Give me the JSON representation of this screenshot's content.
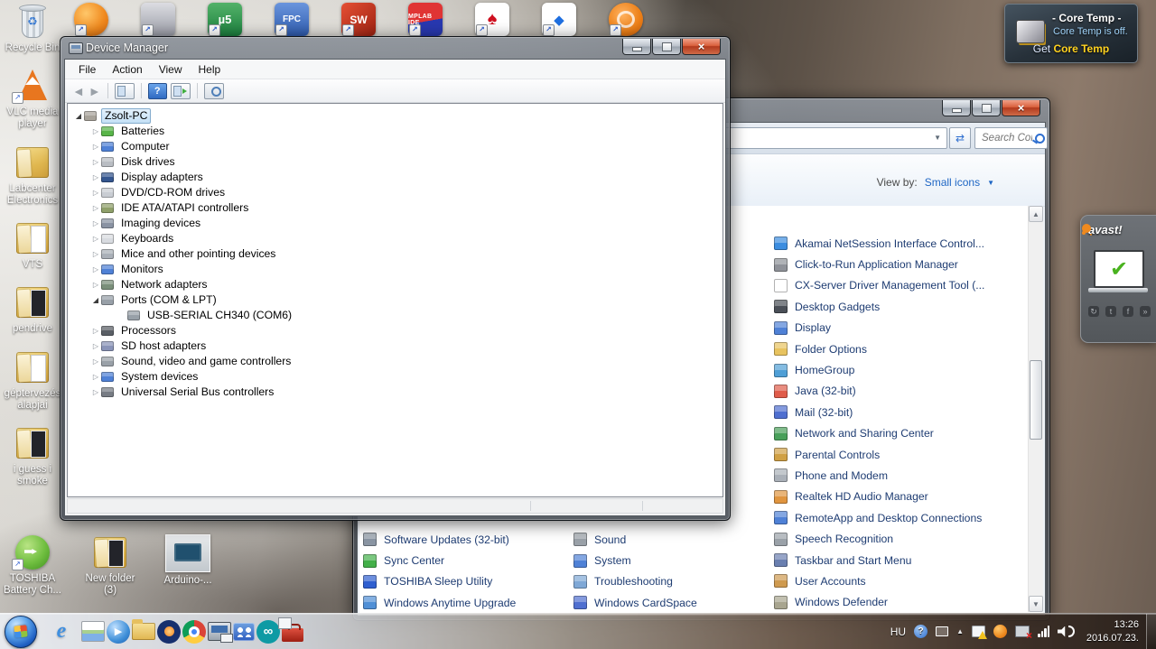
{
  "ui": {
    "shortcut_arrow": "↗",
    "close": "×",
    "back": "◄",
    "forward": "►",
    "help": "?",
    "refresh": "⇄",
    "dropdown": "▼",
    "scroll_up": "▲",
    "scroll_down": "▼",
    "tray_hidden": "▲",
    "check": "✔",
    "recycle": "♻",
    "play": "▶",
    "infinity": "∞",
    "social": [
      "↻",
      "t",
      "f",
      "»"
    ]
  },
  "shortcut_row": [
    {
      "name": "avast-shortcut-icon",
      "glyph": "",
      "cls": "sc-avast",
      "shortcut": true
    },
    {
      "name": "media-suite-shortcut-icon",
      "glyph": "",
      "cls": "sc-gray",
      "shortcut": true
    },
    {
      "name": "keil-uvision5-shortcut-icon",
      "glyph": "µ5",
      "cls": "sc-keil",
      "shortcut": true
    },
    {
      "name": "fpc-shortcut-icon",
      "glyph": "FPC",
      "cls": "sc-fpc",
      "shortcut": true
    },
    {
      "name": "solidworks-shortcut-icon",
      "glyph": "SW",
      "cls": "sc-sw",
      "shortcut": true
    },
    {
      "name": "mplab-ide-shortcut-icon",
      "glyph": "MPLAB IDE",
      "cls": "sc-mplab",
      "shortcut": true
    },
    {
      "name": "pokerstars-shortcut-icon",
      "glyph": "♠",
      "cls": "sc-ps",
      "shortcut": true
    },
    {
      "name": "dropbox-shortcut-icon",
      "glyph": "◆",
      "cls": "sc-dropbox",
      "shortcut": true
    },
    {
      "name": "orange-wheel-shortcut-icon",
      "glyph": "",
      "cls": "sc-orange",
      "shortcut": true
    }
  ],
  "desktop_icons": [
    {
      "name": "desktop-icon-recycle-bin",
      "label": "Recycle Bin",
      "cls": "ic-bin",
      "glyph": "♻"
    },
    {
      "name": "desktop-icon-vlc",
      "label": "VLC media player",
      "cls": "ic-vlc",
      "shortcut": true
    },
    {
      "name": "desktop-icon-labcenter",
      "label": "Labcenter Electronics",
      "cls": "ic-folder"
    },
    {
      "name": "desktop-icon-vts",
      "label": "VTS",
      "cls": "ic-folder-doc"
    },
    {
      "name": "desktop-icon-pendrive",
      "label": "pendrive",
      "cls": "ic-folder-photo"
    },
    {
      "name": "desktop-icon-geptervezes",
      "label": "géptervezés alapjai",
      "cls": "ic-folder-doc"
    },
    {
      "name": "desktop-icon-i-guess-i-smoke",
      "label": "i guess i smoke",
      "cls": "ic-folder-photo"
    }
  ],
  "desktop_icons_bottom": [
    {
      "name": "desktop-icon-toshiba-battery",
      "label": "TOSHIBA Battery Ch...",
      "cls": "ic-toshiba",
      "shortcut": true
    },
    {
      "name": "desktop-icon-new-folder-3",
      "label": "New folder (3)",
      "cls": "ic-folder-photo"
    },
    {
      "name": "desktop-icon-arduino-photo",
      "label": "Arduino-...",
      "cls": "ic-arduino"
    }
  ],
  "device_manager": {
    "title": "Device Manager",
    "menu": [
      {
        "name": "menu-file",
        "label": "File"
      },
      {
        "name": "menu-action",
        "label": "Action"
      },
      {
        "name": "menu-view",
        "label": "View"
      },
      {
        "name": "menu-help",
        "label": "Help"
      }
    ],
    "tree": [
      {
        "name": "tree-item-zsolt-pc",
        "label": "Zsolt-PC",
        "twisty": "◢",
        "ic": "#a8a39a",
        "cls": "lvl0 sel open"
      },
      {
        "name": "tree-item-batteries",
        "label": "Batteries",
        "twisty": "▷",
        "ic": "#58b549",
        "cls": "lvl1"
      },
      {
        "name": "tree-item-computer",
        "label": "Computer",
        "twisty": "▷",
        "ic": "#4f81d6",
        "cls": "lvl1"
      },
      {
        "name": "tree-item-disk-drives",
        "label": "Disk drives",
        "twisty": "▷",
        "ic": "#b9bdc3",
        "cls": "lvl1"
      },
      {
        "name": "tree-item-display-adapters",
        "label": "Display adapters",
        "twisty": "▷",
        "ic": "#35568f",
        "cls": "lvl1"
      },
      {
        "name": "tree-item-dvd-cd-rom-drives",
        "label": "DVD/CD-ROM drives",
        "twisty": "▷",
        "ic": "#c9cdd3",
        "cls": "lvl1"
      },
      {
        "name": "tree-item-ide-ata-atapi-controllers",
        "label": "IDE ATA/ATAPI controllers",
        "twisty": "▷",
        "ic": "#8fa06a",
        "cls": "lvl1"
      },
      {
        "name": "tree-item-imaging-devices",
        "label": "Imaging devices",
        "twisty": "▷",
        "ic": "#8a93a3",
        "cls": "lvl1"
      },
      {
        "name": "tree-item-keyboards",
        "label": "Keyboards",
        "twisty": "▷",
        "ic": "#d8dbe0",
        "cls": "lvl1"
      },
      {
        "name": "tree-item-mice",
        "label": "Mice and other pointing devices",
        "twisty": "▷",
        "ic": "#aab0b8",
        "cls": "lvl1"
      },
      {
        "name": "tree-item-monitors",
        "label": "Monitors",
        "twisty": "▷",
        "ic": "#4f81d6",
        "cls": "lvl1"
      },
      {
        "name": "tree-item-network-adapters",
        "label": "Network adapters",
        "twisty": "▷",
        "ic": "#7a8f7a",
        "cls": "lvl1"
      },
      {
        "name": "tree-item-ports-com-lpt",
        "label": "Ports (COM & LPT)",
        "twisty": "◢",
        "ic": "#98a0a8",
        "cls": "lvl1 open"
      },
      {
        "name": "tree-item-usb-serial-ch340-com6",
        "label": "USB-SERIAL CH340 (COM6)",
        "twisty": "",
        "ic": "#98a0a8",
        "cls": "lvl2"
      },
      {
        "name": "tree-item-processors",
        "label": "Processors",
        "twisty": "▷",
        "ic": "#5a5f66",
        "cls": "lvl1"
      },
      {
        "name": "tree-item-sd-host-adapters",
        "label": "SD host adapters",
        "twisty": "▷",
        "ic": "#8a94b8",
        "cls": "lvl1"
      },
      {
        "name": "tree-item-sound-video-game",
        "label": "Sound, video and game controllers",
        "twisty": "▷",
        "ic": "#9aa1a8",
        "cls": "lvl1"
      },
      {
        "name": "tree-item-system-devices",
        "label": "System devices",
        "twisty": "▷",
        "ic": "#4f81d6",
        "cls": "lvl1"
      },
      {
        "name": "tree-item-usb-controllers",
        "label": "Universal Serial Bus controllers",
        "twisty": "▷",
        "ic": "#777c84",
        "cls": "lvl1"
      }
    ]
  },
  "control_panel": {
    "search_placeholder": "Search Con...",
    "view_by_label": "View by:",
    "view_by_value": "Small icons",
    "items_left": [
      {
        "name": "cp-item-software-updates",
        "label": "Software Updates (32-bit)",
        "ic": "#8a95a3"
      },
      {
        "name": "cp-item-sync-center",
        "label": "Sync Center",
        "ic": "#43b049"
      },
      {
        "name": "cp-item-toshiba-sleep-utility",
        "label": "TOSHIBA Sleep Utility",
        "ic": "#2f5fd0"
      },
      {
        "name": "cp-item-windows-anytime-upgrade",
        "label": "Windows Anytime Upgrade",
        "ic": "#4f8fd6"
      }
    ],
    "items_middle": [
      {
        "name": "cp-item-sound",
        "label": "Sound",
        "ic": "#9aa1a8"
      },
      {
        "name": "cp-item-system",
        "label": "System",
        "ic": "#4f81d6"
      },
      {
        "name": "cp-item-troubleshooting",
        "label": "Troubleshooting",
        "ic": "#7fa8d6"
      },
      {
        "name": "cp-item-windows-cardspace",
        "label": "Windows CardSpace",
        "ic": "#4f6fd0"
      }
    ],
    "items_right": [
      {
        "name": "cp-item-akamai",
        "label": "Akamai NetSession Interface Control...",
        "ic": "#3b8de0"
      },
      {
        "name": "cp-item-click-to-run",
        "label": "Click-to-Run Application Manager",
        "ic": "#8f9299"
      },
      {
        "name": "cp-item-cx-server",
        "label": "CX-Server Driver Management Tool (...",
        "ic": "#ffffff"
      },
      {
        "name": "cp-item-desktop-gadgets",
        "label": "Desktop Gadgets",
        "ic": "#4a4f57"
      },
      {
        "name": "cp-item-display",
        "label": "Display",
        "ic": "#4f81d6"
      },
      {
        "name": "cp-item-folder-options",
        "label": "Folder Options",
        "ic": "#e8c35f"
      },
      {
        "name": "cp-item-homegroup",
        "label": "HomeGroup",
        "ic": "#4f9fd6"
      },
      {
        "name": "cp-item-java",
        "label": "Java (32-bit)",
        "ic": "#e05c4a"
      },
      {
        "name": "cp-item-mail",
        "label": "Mail (32-bit)",
        "ic": "#4f6fd0"
      },
      {
        "name": "cp-item-network-sharing-center",
        "label": "Network and Sharing Center",
        "ic": "#49a05a"
      },
      {
        "name": "cp-item-parental-controls",
        "label": "Parental Controls",
        "ic": "#d0a044"
      },
      {
        "name": "cp-item-phone-modem",
        "label": "Phone and Modem",
        "ic": "#aab0b8"
      },
      {
        "name": "cp-item-realtek-hd-audio",
        "label": "Realtek HD Audio Manager",
        "ic": "#e0953f"
      },
      {
        "name": "cp-item-remoteapp",
        "label": "RemoteApp and Desktop Connections",
        "ic": "#4f81d6"
      },
      {
        "name": "cp-item-speech-recognition",
        "label": "Speech Recognition",
        "ic": "#9aa1a8"
      },
      {
        "name": "cp-item-taskbar-start-menu",
        "label": "Taskbar and Start Menu",
        "ic": "#6a7fb0"
      },
      {
        "name": "cp-item-user-accounts",
        "label": "User Accounts",
        "ic": "#cf9a4f"
      },
      {
        "name": "cp-item-windows-defender",
        "label": "Windows Defender",
        "ic": "#a8a58f"
      }
    ]
  },
  "core_temp": {
    "title": "- Core Temp -",
    "status": "Core Temp is off.",
    "get_prefix": "Get ",
    "get_product": "Core Temp"
  },
  "avast": {
    "logo": "avast!"
  },
  "taskbar": {
    "buttons": [
      {
        "name": "taskbar-ie-button",
        "cls": "g-ie",
        "glyph": "e"
      },
      {
        "name": "taskbar-paint-button",
        "cls": "g-paint",
        "glyph": ""
      },
      {
        "name": "taskbar-wmp-button",
        "cls": "g-wmp",
        "glyph": "▶"
      },
      {
        "name": "taskbar-explorer-button",
        "cls": "g-folder",
        "glyph": "",
        "pressed": true
      },
      {
        "name": "taskbar-audacity-button",
        "cls": "g-aud",
        "glyph": ""
      },
      {
        "name": "taskbar-chrome-button",
        "cls": "g-chrome",
        "glyph": "",
        "pressed": true
      },
      {
        "name": "taskbar-device-manager-button",
        "cls": "g-devmgr",
        "glyph": "",
        "pressed": true
      },
      {
        "name": "taskbar-control-panel-button",
        "cls": "g-cpanel",
        "glyph": "",
        "pressed": true
      },
      {
        "name": "taskbar-arduino-button",
        "cls": "g-arduino",
        "glyph": "∞",
        "pressed": true
      },
      {
        "name": "taskbar-toolbox-button",
        "cls": "g-toolbox",
        "glyph": "",
        "pressed": true
      }
    ],
    "tray": {
      "language": "HU",
      "time": "13:26",
      "date": "2016.07.23."
    }
  }
}
